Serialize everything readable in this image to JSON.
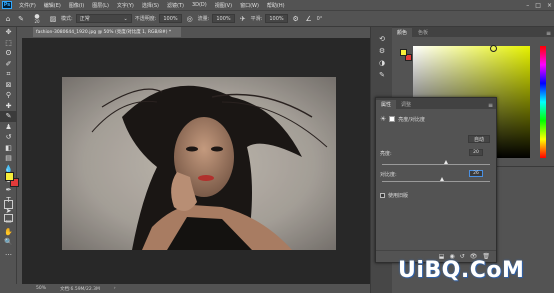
{
  "menubar": {
    "logo": "Ps",
    "items": [
      "文件(F)",
      "编辑(E)",
      "图像(I)",
      "图层(L)",
      "文字(Y)",
      "选择(S)",
      "滤镜(T)",
      "3D(D)",
      "视图(V)",
      "窗口(W)",
      "帮助(H)"
    ],
    "window_controls": [
      "–",
      "□",
      "×"
    ]
  },
  "optbar": {
    "brush_size": "20",
    "mode_label": "模式:",
    "mode_value": "正常",
    "opacity_label": "不透明度:",
    "opacity_value": "100%",
    "flow_label": "流量:",
    "flow_value": "100%",
    "smooth_label": "平滑:",
    "smooth_value": "100%",
    "angle_value": "0°"
  },
  "document": {
    "tab_title": "fashion-3080644_1920.jpg @ 50% (亮度/对比度 1, RGB/8#) *",
    "zoom": "50%",
    "doc_info": "文档:6.59M/22.3M"
  },
  "color_panel": {
    "tabs": [
      "颜色",
      "色板"
    ],
    "foreground": "#f7ee3a",
    "background": "#e23a3a",
    "picker_hue": "#e6f200"
  },
  "properties": {
    "tabs": [
      "属性",
      "调整"
    ],
    "title": "亮度/对比度",
    "auto_button": "自动",
    "brightness_label": "亮度:",
    "brightness_value": "20",
    "brightness_level": 0.6,
    "contrast_label": "对比度:",
    "contrast_value": "26",
    "contrast_level": 0.56,
    "legacy_label": "使用旧版"
  },
  "watermark": "UiBQ.CoM"
}
